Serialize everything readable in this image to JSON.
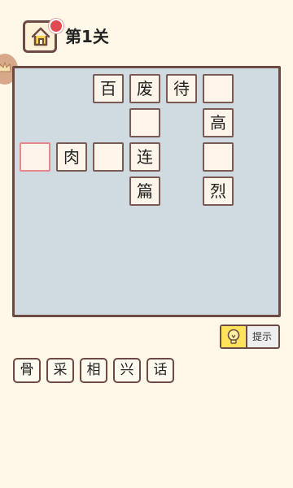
{
  "header": {
    "level_title": "第1关",
    "home_icon": "home-icon",
    "notification_color": "#e04a52"
  },
  "board": {
    "background": "#cfdbe1",
    "cells": [
      {
        "id": "r1c3",
        "char": "百"
      },
      {
        "id": "r1c4",
        "char": "废"
      },
      {
        "id": "r1c5",
        "char": "待"
      },
      {
        "id": "r1c6",
        "char": ""
      },
      {
        "id": "r2c4",
        "char": ""
      },
      {
        "id": "r2c6",
        "char": "高"
      },
      {
        "id": "r3c1",
        "char": "",
        "selected": true
      },
      {
        "id": "r3c2",
        "char": "肉"
      },
      {
        "id": "r3c3",
        "char": ""
      },
      {
        "id": "r3c4",
        "char": "连"
      },
      {
        "id": "r3c6",
        "char": ""
      },
      {
        "id": "r4c4",
        "char": "篇"
      },
      {
        "id": "r4c6",
        "char": "烈"
      }
    ]
  },
  "hint": {
    "label": "提示",
    "icon": "lightbulb-icon"
  },
  "options": [
    "骨",
    "采",
    "相",
    "兴",
    "话"
  ]
}
